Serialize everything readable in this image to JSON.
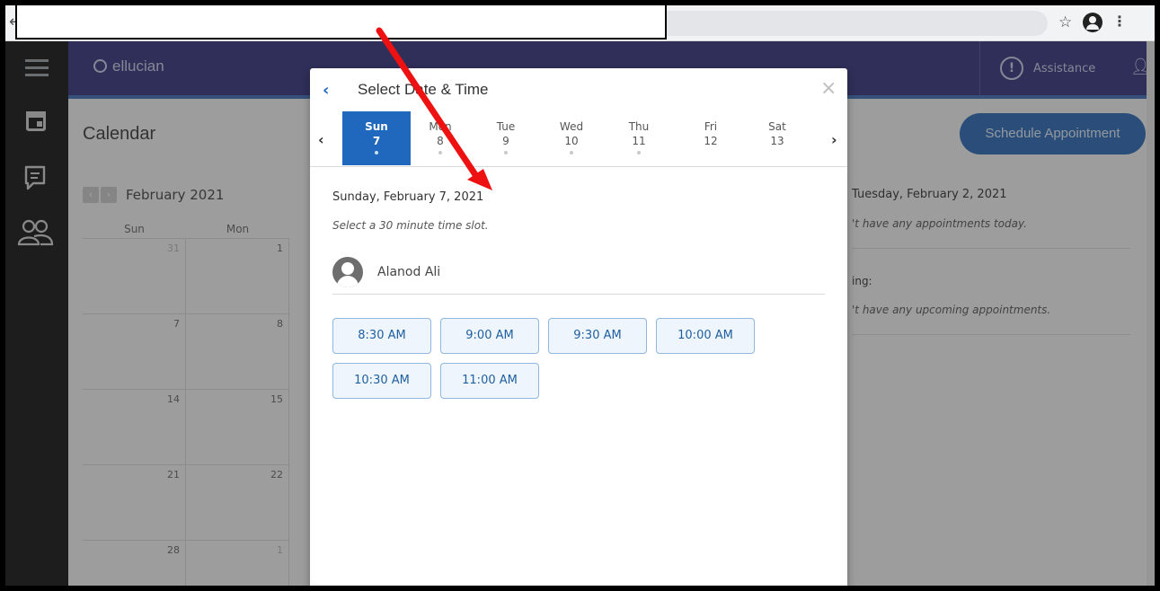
{
  "browser": {
    "back": "←",
    "star": "☆",
    "kebab": "⋮"
  },
  "app": {
    "brand": "ellucian",
    "assistance_label": "Assistance",
    "colors": {
      "navbar": "#36347f",
      "primary": "#1f68bd",
      "rail": "#151515"
    }
  },
  "calendar_page": {
    "title": "Calendar",
    "month_label": "February 2021",
    "prev": "‹",
    "next": "›",
    "weekday_headers": [
      "Sun",
      "Mon"
    ],
    "weeks": [
      [
        "31",
        "1"
      ],
      [
        "7",
        "8"
      ],
      [
        "14",
        "15"
      ],
      [
        "21",
        "22"
      ],
      [
        "28",
        "1"
      ]
    ],
    "schedule_button": "Schedule Appointment",
    "today_heading": "Tuesday, February 2, 2021",
    "today_empty": "'t have any appointments today.",
    "upcoming_heading": "ing:",
    "upcoming_empty": "'t have any upcoming appointments."
  },
  "modal": {
    "back": "‹",
    "title": "Select Date & Time",
    "close": "×",
    "week_prev": "‹",
    "week_next": "›",
    "days": [
      {
        "name": "Sun",
        "date": "7",
        "available": true,
        "selected": true
      },
      {
        "name": "Mon",
        "date": "8",
        "available": true,
        "selected": false
      },
      {
        "name": "Tue",
        "date": "9",
        "available": true,
        "selected": false
      },
      {
        "name": "Wed",
        "date": "10",
        "available": true,
        "selected": false
      },
      {
        "name": "Thu",
        "date": "11",
        "available": true,
        "selected": false
      },
      {
        "name": "Fri",
        "date": "12",
        "available": false,
        "selected": false
      },
      {
        "name": "Sat",
        "date": "13",
        "available": false,
        "selected": false
      }
    ],
    "date_heading": "Sunday, February 7, 2021",
    "slot_hint": "Select a 30 minute time slot.",
    "advisor_name": "Alanod Ali",
    "slots": [
      "8:30 AM",
      "9:00 AM",
      "9:30 AM",
      "10:00 AM",
      "10:30 AM",
      "11:00 AM"
    ]
  }
}
